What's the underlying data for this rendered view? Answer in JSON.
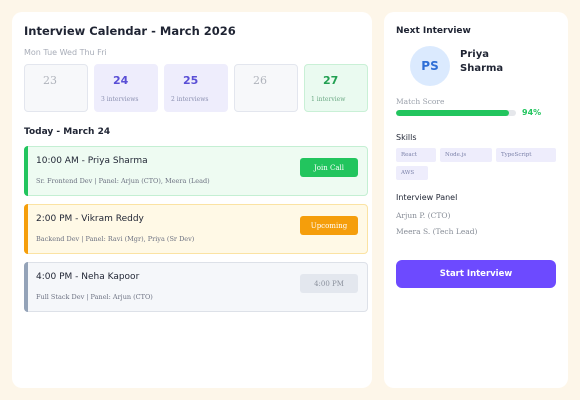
{
  "calendar": {
    "title": "Interview Calendar - March 2026",
    "weekdays": "Mon Tue Wed Thu Fri",
    "days": [
      {
        "num": "23",
        "count": ""
      },
      {
        "num": "24",
        "count": "3 interviews"
      },
      {
        "num": "25",
        "count": "2 interviews"
      },
      {
        "num": "26",
        "count": ""
      },
      {
        "num": "27",
        "count": "1 interview"
      }
    ]
  },
  "today": {
    "label": "Today - March 24",
    "appointments": [
      {
        "time": "10:00 AM - Priya Sharma",
        "meta": "Sr. Frontend Dev | Panel: Arjun (CTO), Meera (Lead)",
        "action": "Join Call",
        "status_color": "#22c55e"
      },
      {
        "time": "2:00 PM - Vikram Reddy",
        "meta": "Backend Dev | Panel: Ravi (Mgr), Priya (Sr Dev)",
        "action": "Upcoming",
        "status_color": "#f59e0b"
      },
      {
        "time": "4:00 PM - Neha Kapoor",
        "meta": "Full Stack Dev | Panel: Arjun (CTO)",
        "action": "4:00 PM",
        "status_color": "#94a3b8"
      }
    ]
  },
  "next_interview": {
    "title": "Next Interview",
    "initials": "PS",
    "name": "Priya Sharma",
    "match_label": "Match Score",
    "match_pct": "94%",
    "match_value": 0.94,
    "skills_label": "Skills",
    "skills": [
      "React",
      "Node.js",
      "TypeScript",
      "AWS"
    ],
    "panel_label": "Interview Panel",
    "panel": [
      "Arjun P. (CTO)",
      "Meera S. (Tech Lead)"
    ],
    "start_label": "Start Interview",
    "accent": "#6d4aff"
  }
}
